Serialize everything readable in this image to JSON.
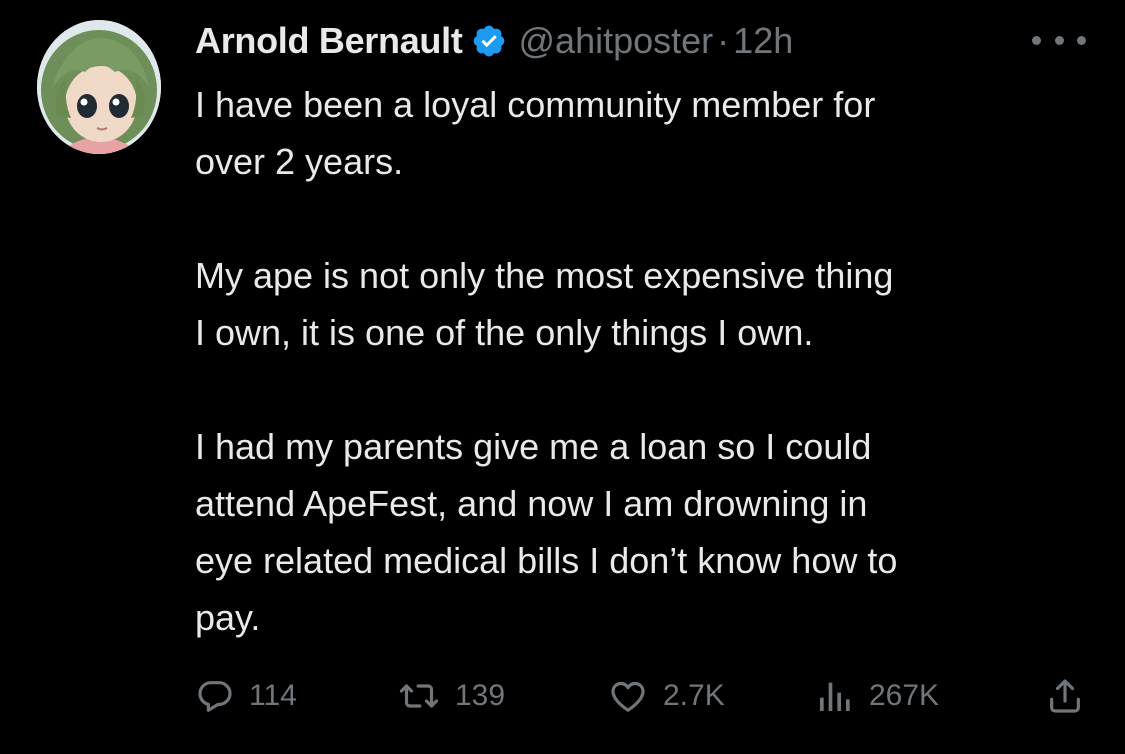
{
  "author": {
    "display_name": "Arnold Bernault",
    "handle": "@ahitposter",
    "separator": "·",
    "time": "12h",
    "verified_icon": "verified-badge-icon",
    "verified_color": "#1d9bf0"
  },
  "tweet": {
    "paragraphs": [
      [
        "I have been a loyal community member for",
        "over 2 years."
      ],
      [
        "My ape is not only the most expensive thing",
        "I own, it is one of the only things I own."
      ],
      [
        "I had my parents give me a loan so I could",
        "attend ApeFest, and now I am drowning in",
        "eye related medical bills I don’t know how to",
        "pay."
      ]
    ]
  },
  "actions": {
    "reply": {
      "icon": "reply-icon",
      "count": "114"
    },
    "retweet": {
      "icon": "retweet-icon",
      "count": "139"
    },
    "like": {
      "icon": "heart-icon",
      "count": "2.7K"
    },
    "views": {
      "icon": "views-icon",
      "count": "267K"
    },
    "share": {
      "icon": "share-icon"
    }
  },
  "colors": {
    "background": "#000000",
    "text_primary": "#e7e9ea",
    "text_secondary": "#71767b"
  }
}
